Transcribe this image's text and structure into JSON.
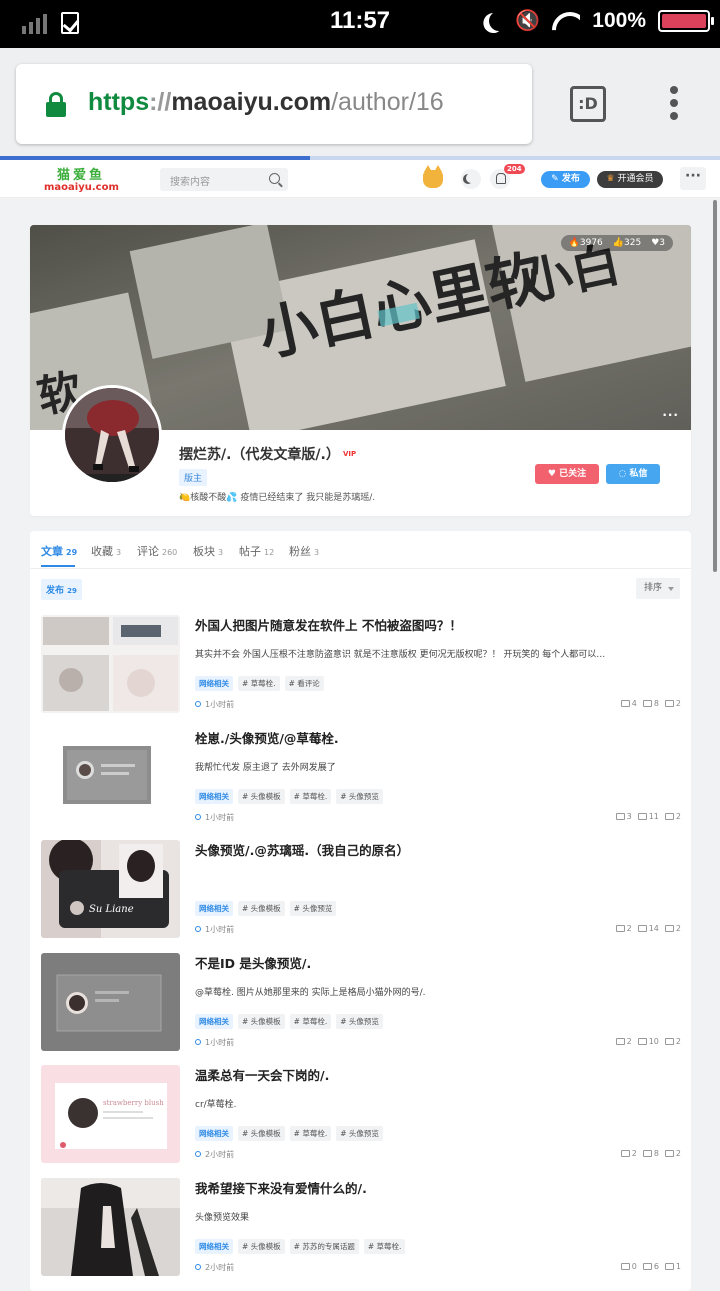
{
  "status_bar": {
    "time": "11:57",
    "battery": "100%",
    "battery_level": 1.0
  },
  "browser": {
    "url_scheme": "https",
    "url_sep": "://",
    "url_host": "maoaiyu.com",
    "url_path": "/author/16",
    "tabs_button": ":D",
    "load_progress": 0.43
  },
  "site_header": {
    "logo_cn": "猫爱鱼",
    "logo_en": "maoaiyu.com",
    "search_placeholder": "搜索内容",
    "notification_count": "204",
    "publish_label": "发布",
    "vip_label": "开通会员",
    "more_label": "···"
  },
  "profile": {
    "stats": {
      "hot": "3976",
      "likes": "325",
      "hearts": "3"
    },
    "name": "摆烂苏/.（代发文章版/.）",
    "vip_badge": "VIP",
    "role": "版主",
    "bio_prefix": "🍋",
    "bio_mid": "核酸不酸",
    "bio_emoji2": "💦",
    "bio_suffix": "疫情已经结束了 我只能是苏璃瑶/.",
    "follow_label": "已关注",
    "message_label": "私信",
    "more_label": "···"
  },
  "tabs": [
    {
      "label": "文章",
      "count": "29"
    },
    {
      "label": "收藏",
      "count": "3"
    },
    {
      "label": "评论",
      "count": "260"
    },
    {
      "label": "板块",
      "count": "3"
    },
    {
      "label": "帖子",
      "count": "12"
    },
    {
      "label": "粉丝",
      "count": "3"
    }
  ],
  "filter": {
    "label": "发布",
    "count": "29",
    "sort_label": "排序"
  },
  "posts": [
    {
      "title": "外国人把图片随意发在软件上 不怕被盗图吗？！",
      "excerpt": "其实并不会 外国人压根不注意防盗意识 就是不注意版权 更何况无版权呢？！ 开玩笑的 每个人都可以…",
      "tags": [
        "网络相关",
        "# 草莓栓.",
        "# 看评论"
      ],
      "time": "1小时前",
      "comments": "4",
      "views": "8",
      "likes": "2"
    },
    {
      "title": "栓崽./头像预览/@草莓栓.",
      "excerpt": "我帮忙代发 原主退了 去外网发展了",
      "tags": [
        "网络相关",
        "# 头像模板",
        "# 草莓栓.",
        "# 头像预览"
      ],
      "time": "1小时前",
      "comments": "3",
      "views": "11",
      "likes": "2"
    },
    {
      "title": "头像预览/.@苏璃瑶.（我自己的原名）",
      "excerpt": "",
      "tags": [
        "网络相关",
        "# 头像模板",
        "# 头像预览"
      ],
      "time": "1小时前",
      "comments": "2",
      "views": "14",
      "likes": "2"
    },
    {
      "title": "不是ID 是头像预览/.",
      "excerpt": "@草莓栓. 图片从她那里来的 实际上是格局小猫外网的号/.",
      "tags": [
        "网络相关",
        "# 头像模板",
        "# 草莓栓.",
        "# 头像预览"
      ],
      "time": "1小时前",
      "comments": "2",
      "views": "10",
      "likes": "2"
    },
    {
      "title": "温柔总有一天会下岗的/.",
      "excerpt": "cr/草莓栓.",
      "tags": [
        "网络相关",
        "# 头像模板",
        "# 草莓栓.",
        "# 头像预览"
      ],
      "time": "2小时前",
      "comments": "2",
      "views": "8",
      "likes": "2"
    },
    {
      "title": "我希望接下来没有爱情什么的/.",
      "excerpt": "头像预览效果",
      "tags": [
        "网络相关",
        "# 头像模板",
        "# 苏苏的专属话题",
        "# 草莓栓."
      ],
      "time": "2小时前",
      "comments": "0",
      "views": "6",
      "likes": "1"
    }
  ]
}
